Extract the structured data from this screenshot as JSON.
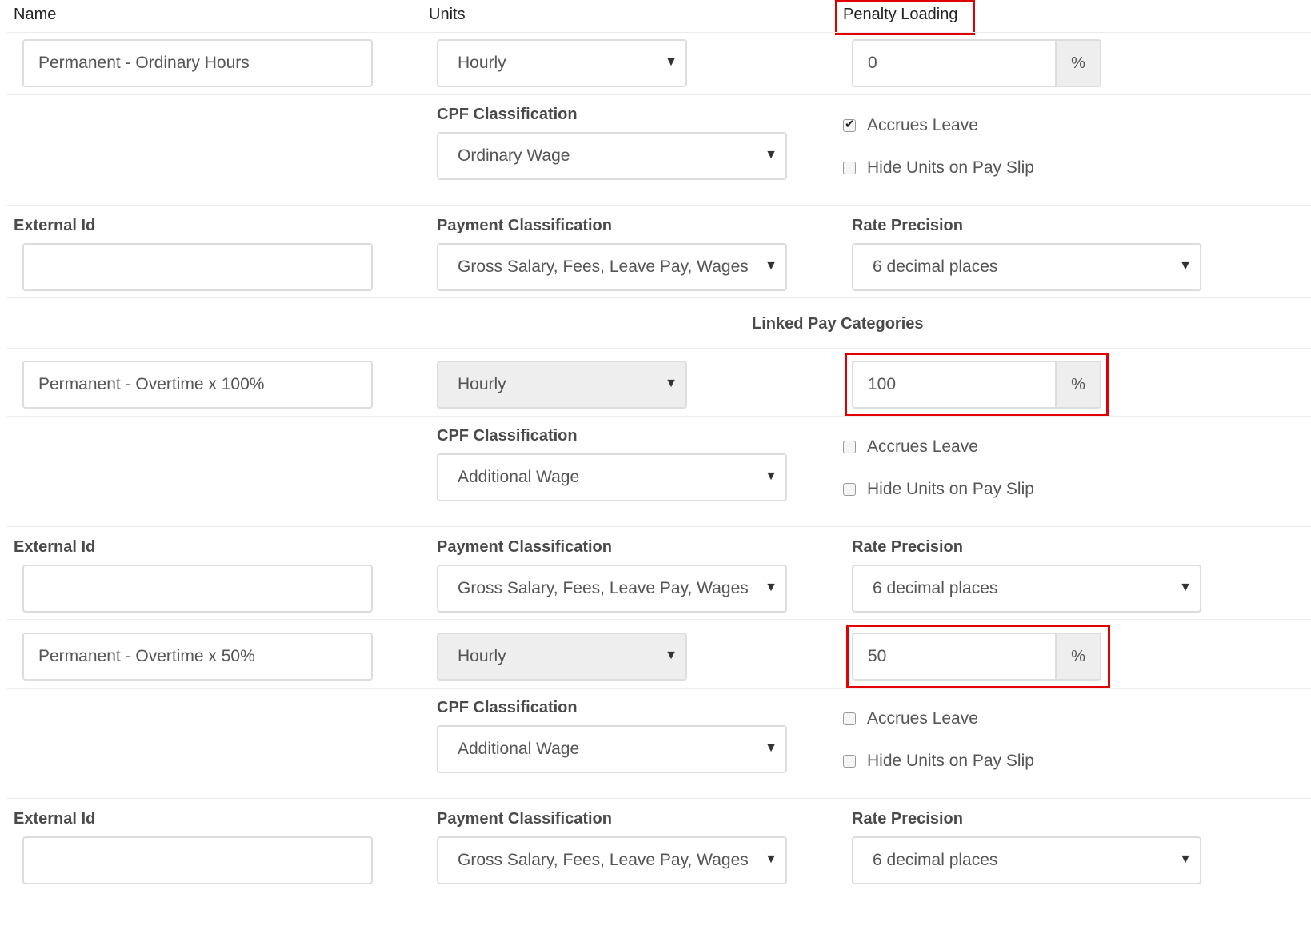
{
  "headers": {
    "name": "Name",
    "units": "Units",
    "penalty_loading": "Penalty Loading"
  },
  "labels": {
    "cpf_classification": "CPF Classification",
    "external_id": "External Id",
    "payment_classification": "Payment Classification",
    "rate_precision": "Rate Precision",
    "accrues_leave": "Accrues Leave",
    "hide_units": "Hide Units on Pay Slip",
    "linked_pay_categories": "Linked Pay Categories",
    "percent": "%"
  },
  "primary": {
    "name": "Permanent - Ordinary Hours",
    "units": "Hourly",
    "penalty": "0",
    "cpf": "Ordinary Wage",
    "accrues_leave": true,
    "hide_units": false,
    "external_id": "",
    "payment_classification": "Gross Salary, Fees, Leave Pay, Wages",
    "rate_precision": "6 decimal places"
  },
  "linked": [
    {
      "name": "Permanent - Overtime x 100%",
      "units": "Hourly",
      "penalty": "100",
      "cpf": "Additional Wage",
      "accrues_leave": false,
      "hide_units": false,
      "external_id": "",
      "payment_classification": "Gross Salary, Fees, Leave Pay, Wages",
      "rate_precision": "6 decimal places"
    },
    {
      "name": "Permanent - Overtime x 50%",
      "units": "Hourly",
      "penalty": "50",
      "cpf": "Additional Wage",
      "accrues_leave": false,
      "hide_units": false,
      "external_id": "",
      "payment_classification": "Gross Salary, Fees, Leave Pay, Wages",
      "rate_precision": "6 decimal places"
    }
  ],
  "colors": {
    "highlight": "#e00000",
    "border": "#dddddd",
    "disabled_bg": "#eeeeee"
  }
}
